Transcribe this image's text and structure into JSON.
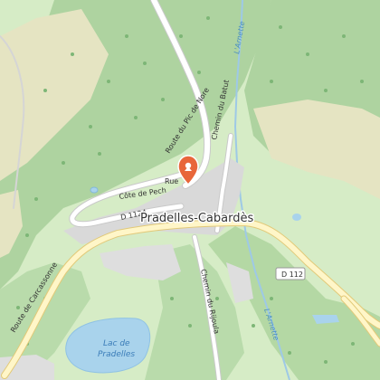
{
  "map": {
    "town": "Pradelles-Cabardès",
    "lake": {
      "line1": "Lac de",
      "line2": "Pradelles"
    },
    "roads": {
      "route_pic_nore": "Route du Pic de Nore",
      "chemin_batut": "Chemin du Batut",
      "cote_pech": "Côte de Pech",
      "rue": "Rue",
      "d1124": "D 1124",
      "d112": "D 112",
      "route_carcassonne": "Route de Carcassonne",
      "chemin_rijoula": "Chemin du Rijoula"
    },
    "rivers": {
      "arnette_north": "L'Arnette",
      "arnette_south": "L'Arnette"
    },
    "marker": {
      "icon": "location-pin-icon",
      "color": "#e8663a"
    },
    "colors": {
      "forest": "#a9cf9b",
      "meadow": "#dbeec9",
      "fields": "#e5e4c2",
      "water": "#a9d3ec",
      "river": "#9ec9e6",
      "road": "#ffffff",
      "road_casing": "#c9c9c9",
      "major_road": "#fff6c8",
      "major_road_casing": "#e2c978",
      "built": "#d4d4d4"
    }
  }
}
